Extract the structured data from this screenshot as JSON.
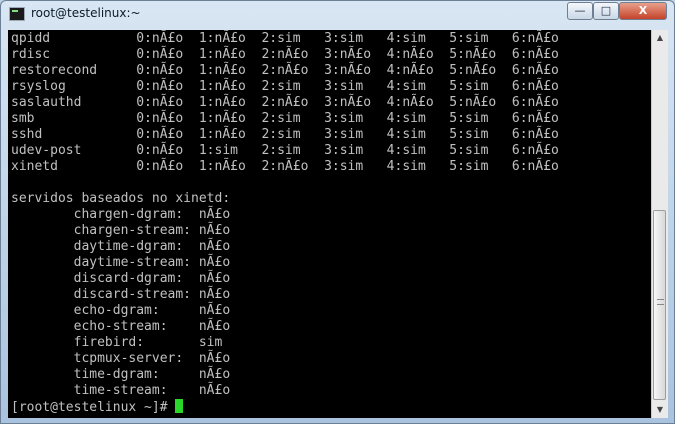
{
  "window": {
    "title": "root@testelinux:~",
    "controls": {
      "minimize": "—",
      "maximize": "□",
      "close": "X"
    }
  },
  "terminal": {
    "lines": [
      "qpidd           0:nÃ£o  1:nÃ£o  2:sim   3:sim   4:sim   5:sim   6:nÃ£o",
      "rdisc           0:nÃ£o  1:nÃ£o  2:nÃ£o  3:nÃ£o  4:nÃ£o  5:nÃ£o  6:nÃ£o",
      "restorecond     0:nÃ£o  1:nÃ£o  2:nÃ£o  3:nÃ£o  4:nÃ£o  5:nÃ£o  6:nÃ£o",
      "rsyslog         0:nÃ£o  1:nÃ£o  2:sim   3:sim   4:sim   5:sim   6:nÃ£o",
      "saslauthd       0:nÃ£o  1:nÃ£o  2:nÃ£o  3:nÃ£o  4:nÃ£o  5:nÃ£o  6:nÃ£o",
      "smb             0:nÃ£o  1:nÃ£o  2:sim   3:sim   4:sim   5:sim   6:nÃ£o",
      "sshd            0:nÃ£o  1:nÃ£o  2:sim   3:sim   4:sim   5:sim   6:nÃ£o",
      "udev-post       0:nÃ£o  1:sim   2:sim   3:sim   4:sim   5:sim   6:nÃ£o",
      "xinetd          0:nÃ£o  1:nÃ£o  2:nÃ£o  3:sim   4:sim   5:sim   6:nÃ£o",
      "",
      "servidos baseados no xinetd:",
      "        chargen-dgram:  nÃ£o",
      "        chargen-stream: nÃ£o",
      "        daytime-dgram:  nÃ£o",
      "        daytime-stream: nÃ£o",
      "        discard-dgram:  nÃ£o",
      "        discard-stream: nÃ£o",
      "        echo-dgram:     nÃ£o",
      "        echo-stream:    nÃ£o",
      "        firebird:       sim",
      "        tcpmux-server:  nÃ£o",
      "        time-dgram:     nÃ£o",
      "        time-stream:    nÃ£o"
    ],
    "prompt": "[root@testelinux ~]# "
  },
  "scrollbar": {
    "up_arrow": "▲",
    "down_arrow": "▼"
  }
}
